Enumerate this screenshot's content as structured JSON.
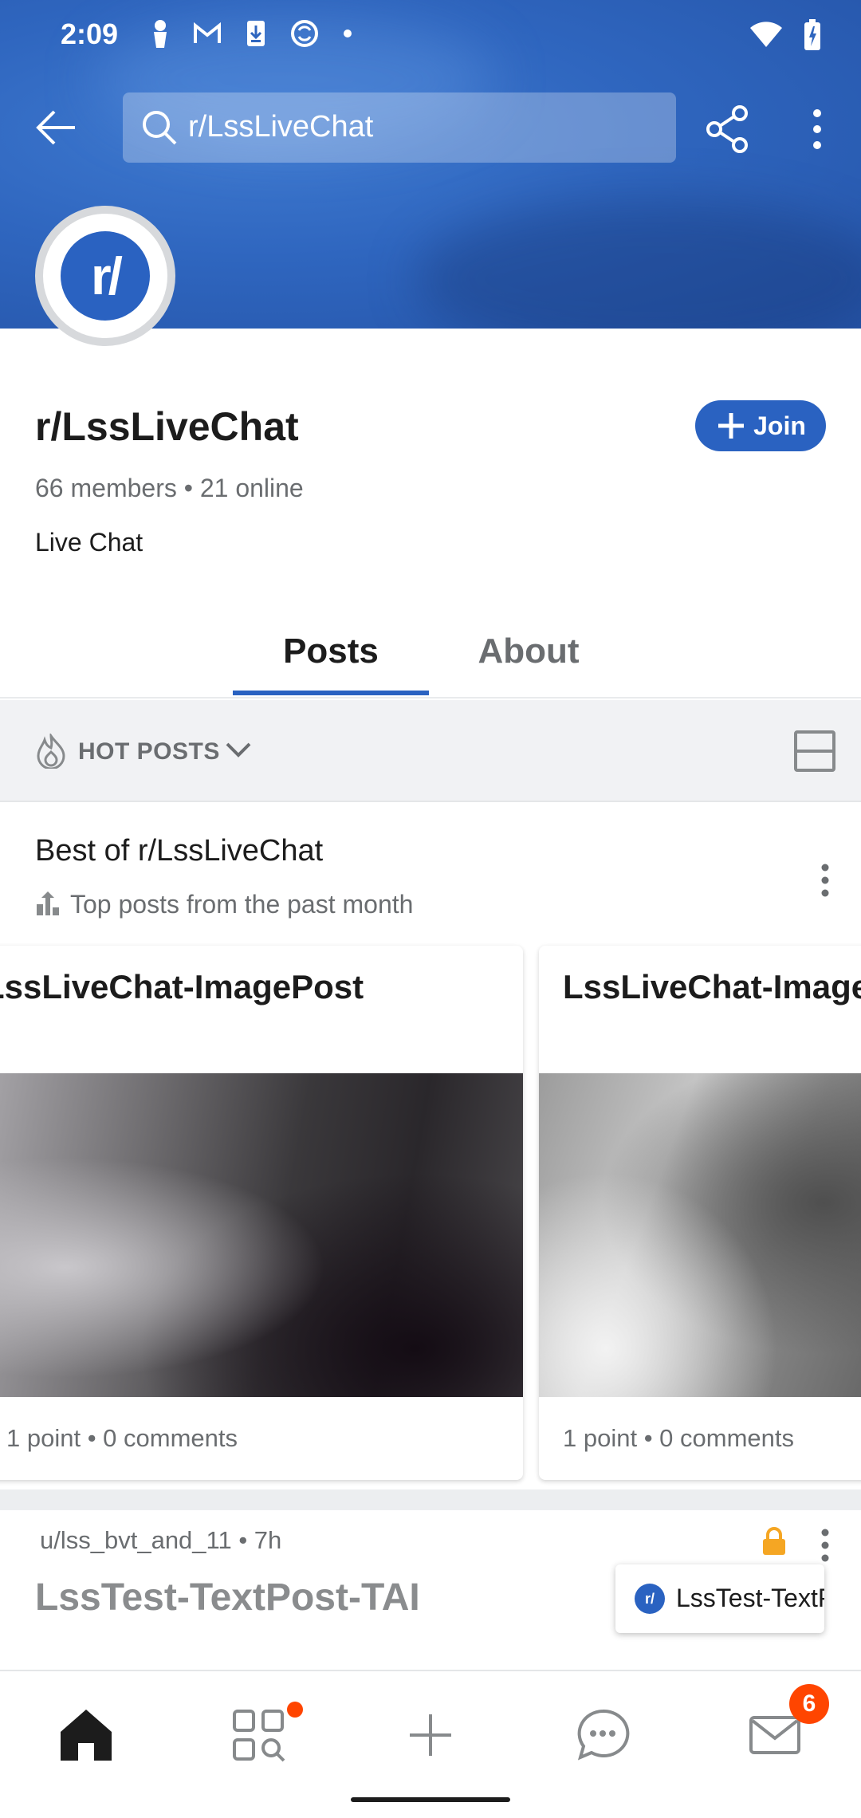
{
  "status_bar": {
    "time": "2:09"
  },
  "search": {
    "value": "r/LssLiveChat"
  },
  "community": {
    "avatar_text": "r/",
    "name": "r/LssLiveChat",
    "join_label": "Join",
    "members": "66 members • 21 online",
    "description": "Live Chat"
  },
  "tabs": [
    {
      "label": "Posts",
      "active": true
    },
    {
      "label": "About",
      "active": false
    }
  ],
  "sort": {
    "label": "HOT POSTS"
  },
  "best_of": {
    "title": "Best of r/LssLiveChat",
    "subtitle": "Top posts from the past month",
    "cards": [
      {
        "title": "LssLiveChat-ImagePost",
        "meta": "1 point • 0 comments"
      },
      {
        "title": "LssLiveChat-ImagePost",
        "meta": "1 point • 0 comments"
      }
    ]
  },
  "post": {
    "author": "u/lss_bvt_and_11 • 7h",
    "title": "LssTest-TextPost-TAI"
  },
  "toast": {
    "icon_text": "r/",
    "text": "LssTest-TextPost"
  },
  "bottom_nav": {
    "inbox_badge": "6",
    "items": [
      "home-icon",
      "discover-icon",
      "create-icon",
      "chat-icon",
      "inbox-icon"
    ]
  },
  "colors": {
    "accent": "#2a62c1",
    "badge": "#ff4500",
    "lock": "#f5a623"
  }
}
